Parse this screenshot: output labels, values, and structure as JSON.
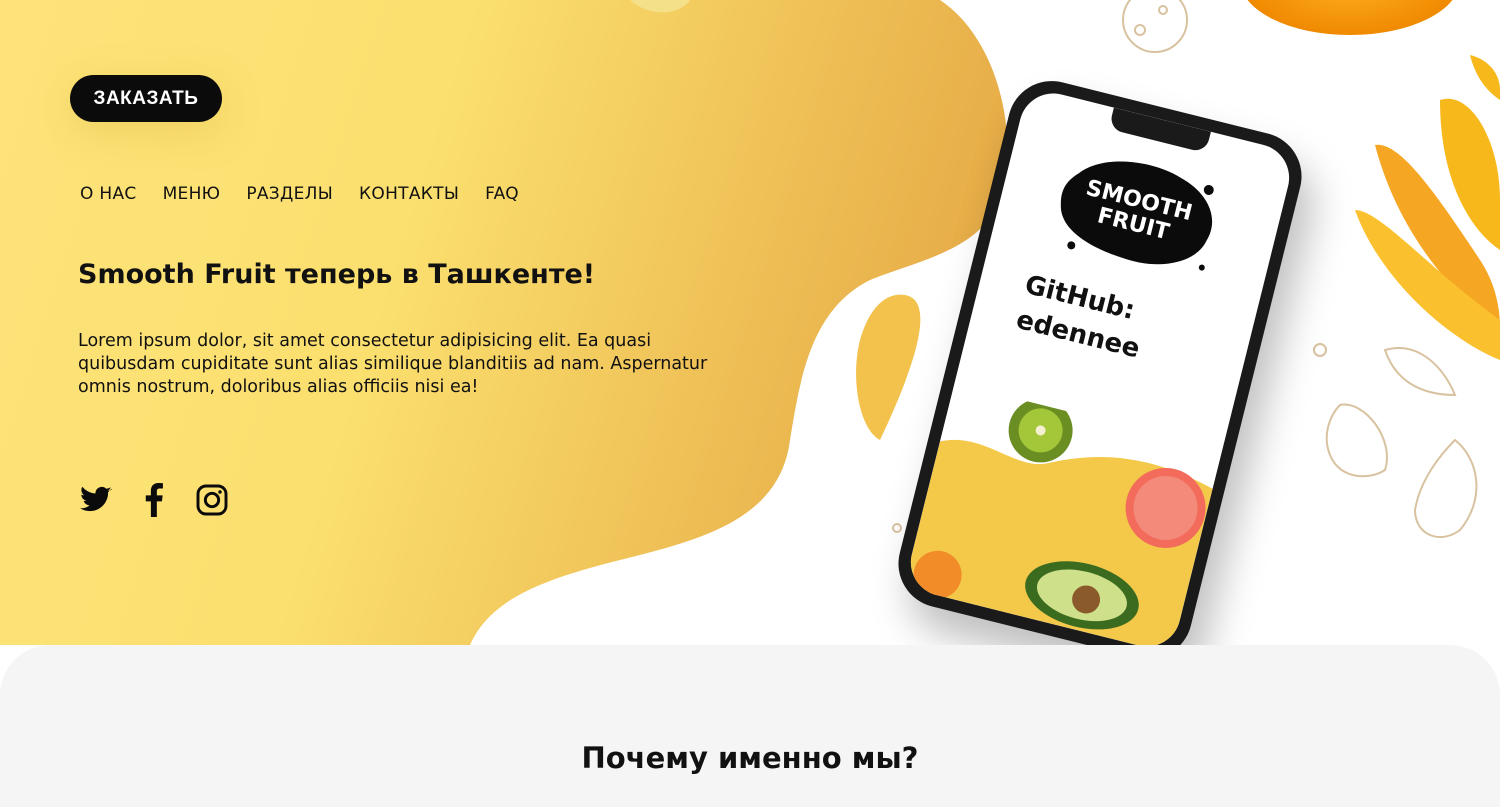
{
  "header": {
    "order_button_label": "ЗАКАЗАТЬ"
  },
  "nav": {
    "items": [
      "О НАС",
      "МЕНЮ",
      "РАЗДЕЛЫ",
      "КОНТАКТЫ",
      "FAQ"
    ]
  },
  "hero": {
    "title": "Smooth Fruit теперь в Ташкенте!",
    "description": "Lorem ipsum dolor, sit amet consectetur adipisicing elit. Ea quasi quibusdam cupiditate sunt alias similique blanditiis ad nam. Aspernatur omnis nostrum, doloribus alias officiis nisi ea!"
  },
  "socials": [
    {
      "name": "twitter-icon"
    },
    {
      "name": "facebook-icon"
    },
    {
      "name": "instagram-icon"
    }
  ],
  "phone": {
    "logo_line1": "SMOOTH",
    "logo_line2": "FRUIT",
    "github_line1": "GitHub:",
    "github_line2": "edennee"
  },
  "why_section": {
    "title": "Почему именно мы?"
  },
  "colors": {
    "yellow_light": "#fce67a",
    "yellow_dark": "#e9b24b",
    "black": "#0b0b0b",
    "section_gray": "#f5f5f5"
  }
}
